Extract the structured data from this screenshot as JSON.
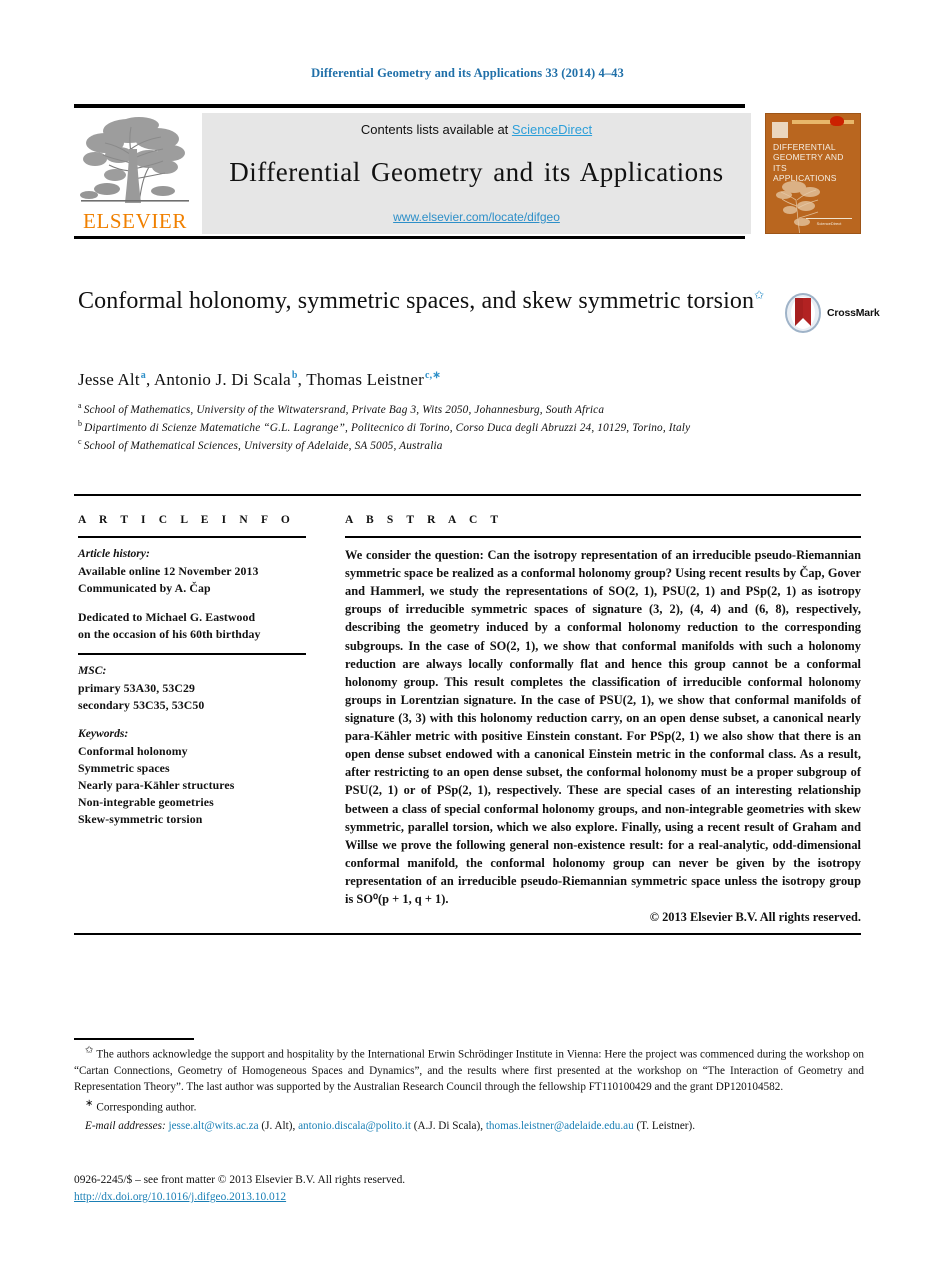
{
  "running_head": "Differential Geometry and its Applications 33 (2014) 4–43",
  "masthead": {
    "contents_prefix": "Contents lists available at ",
    "contents_link": "ScienceDirect",
    "journal_title": "Differential Geometry and its Applications",
    "journal_url": "www.elsevier.com/locate/difgeo",
    "publisher_wordmark": "ELSEVIER",
    "cover": {
      "title_lines": [
        "DIFFERENTIAL",
        "GEOMETRY AND ITS",
        "APPLICATIONS"
      ],
      "footer_text": "ScienceDirect"
    }
  },
  "article": {
    "title": "Conformal holonomy, symmetric spaces, and skew symmetric torsion",
    "title_footnote_marker": "✩",
    "crossmark_label": "CrossMark",
    "authors_html": "Jesse Alt <sup>a</sup>, Antonio J. Di Scala <sup>b</sup>, Thomas Leistner <sup>c,∗</sup>",
    "affiliations": [
      {
        "marker": "a",
        "text": "School of Mathematics, University of the Witwatersrand, Private Bag 3, Wits 2050, Johannesburg, South Africa"
      },
      {
        "marker": "b",
        "text": "Dipartimento di Scienze Matematiche “G.L. Lagrange”, Politecnico di Torino, Corso Duca degli Abruzzi 24, 10129, Torino, Italy"
      },
      {
        "marker": "c",
        "text": "School of Mathematical Sciences, University of Adelaide, SA 5005, Australia"
      }
    ]
  },
  "article_info": {
    "heading": "A R T I C L E   I N F O",
    "history_title": "Article history:",
    "history_lines": [
      "Available online 12 November 2013",
      "Communicated by A. Čap"
    ],
    "dedication_lines": [
      "Dedicated to Michael G. Eastwood",
      "on the occasion of his 60th birthday"
    ],
    "msc_title": "MSC:",
    "msc_lines": [
      "primary 53A30, 53C29",
      "secondary 53C35, 53C50"
    ],
    "keywords_title": "Keywords:",
    "keywords": [
      "Conformal holonomy",
      "Symmetric spaces",
      "Nearly para-Kähler structures",
      "Non-integrable geometries",
      "Skew-symmetric torsion"
    ]
  },
  "abstract": {
    "heading": "A B S T R A C T",
    "body": "We consider the question: Can the isotropy representation of an irreducible pseudo-Riemannian symmetric space be realized as a conformal holonomy group? Using recent results by Čap, Gover and Hammerl, we study the representations of SO(2, 1), PSU(2, 1) and PSp(2, 1) as isotropy groups of irreducible symmetric spaces of signature (3, 2), (4, 4) and (6, 8), respectively, describing the geometry induced by a conformal holonomy reduction to the corresponding subgroups. In the case of SO(2, 1), we show that conformal manifolds with such a holonomy reduction are always locally conformally flat and hence this group cannot be a conformal holonomy group. This result completes the classification of irreducible conformal holonomy groups in Lorentzian signature. In the case of PSU(2, 1), we show that conformal manifolds of signature (3, 3) with this holonomy reduction carry, on an open dense subset, a canonical nearly para-Kähler metric with positive Einstein constant. For PSp(2, 1) we also show that there is an open dense subset endowed with a canonical Einstein metric in the conformal class. As a result, after restricting to an open dense subset, the conformal holonomy must be a proper subgroup of PSU(2, 1) or of PSp(2, 1), respectively. These are special cases of an interesting relationship between a class of special conformal holonomy groups, and non-integrable geometries with skew symmetric, parallel torsion, which we also explore. Finally, using a recent result of Graham and Willse we prove the following general non-existence result: for a real-analytic, odd-dimensional conformal manifold, the conformal holonomy group can never be given by the isotropy representation of an irreducible pseudo-Riemannian symmetric space unless the isotropy group is SO⁰(p + 1, q + 1).",
    "copyright": "© 2013 Elsevier B.V. All rights reserved."
  },
  "footnotes": {
    "star_marker": "✩",
    "star_text": "The authors acknowledge the support and hospitality by the International Erwin Schrödinger Institute in Vienna: Here the project was commenced during the workshop on “Cartan Connections, Geometry of Homogeneous Spaces and Dynamics”, and the results where first presented at the workshop on “The Interaction of Geometry and Representation Theory”. The last author was supported by the Australian Research Council through the fellowship FT110100429 and the grant DP120104582.",
    "corresponding_marker": "∗",
    "corresponding_text": "Corresponding author.",
    "email_label": "E-mail addresses:",
    "emails": [
      {
        "address": "jesse.alt@wits.ac.za",
        "owner": "(J. Alt)"
      },
      {
        "address": "antonio.discala@polito.it",
        "owner": "(A.J. Di Scala)"
      },
      {
        "address": "thomas.leistner@adelaide.edu.au",
        "owner": "(T. Leistner)."
      }
    ]
  },
  "frontmatter": {
    "issn_line": "0926-2245/$ – see front matter © 2013 Elsevier B.V. All rights reserved.",
    "doi": "http://dx.doi.org/10.1016/j.difgeo.2013.10.012"
  },
  "colors": {
    "header_blue": "#1f6fa8",
    "link_blue": "#1a7fb5",
    "sciencedirect_blue": "#2d9fd9",
    "elsevier_orange": "#f08000",
    "cover_orange": "#b9661f"
  }
}
